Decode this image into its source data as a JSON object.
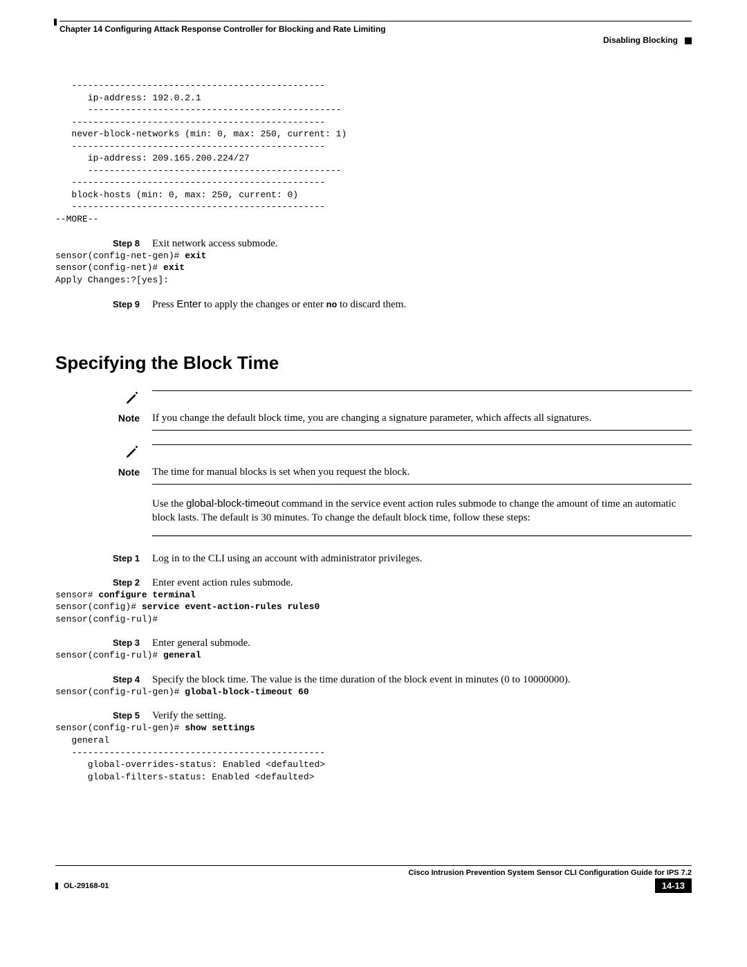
{
  "header": {
    "chapter": "Chapter 14      Configuring Attack Response Controller for Blocking and Rate Limiting",
    "section": "Disabling Blocking"
  },
  "code_block_top": "   -----------------------------------------------\n      ip-address: 192.0.2.1\n      -----------------------------------------------\n   -----------------------------------------------\n   never-block-networks (min: 0, max: 250, current: 1)\n   -----------------------------------------------\n      ip-address: 209.165.200.224/27\n      -----------------------------------------------\n   -----------------------------------------------\n   block-hosts (min: 0, max: 250, current: 0)\n   -----------------------------------------------\n--MORE--",
  "step8": {
    "label": "Step 8",
    "text": "Exit network access submode.",
    "code": "sensor(config-net-gen)# exit\nsensor(config-net)# exit\nApply Changes:?[yes]:"
  },
  "step9": {
    "label": "Step 9",
    "text_pre": "Press ",
    "enter": "Enter",
    "text_mid": " to apply the changes or enter ",
    "no_word": "no",
    "text_post": " to discard them."
  },
  "heading": "Specifying the Block Time",
  "note1": {
    "label": "Note",
    "text": "If you change the default block time, you are changing a signature parameter, which affects all signatures."
  },
  "note2": {
    "label": "Note",
    "text": "The time for manual blocks is set when you request the block."
  },
  "intro": {
    "pre": "Use the ",
    "cmd": "global-block-timeout",
    "post": " command in the service event action rules submode to change the amount of time an automatic block lasts. The default is 30 minutes. To change the default block time, follow these steps:"
  },
  "bstep1": {
    "label": "Step 1",
    "text": "Log in to the CLI using an account with administrator privileges."
  },
  "bstep2": {
    "label": "Step 2",
    "text": "Enter event action rules submode.",
    "code_plain1": "sensor# ",
    "code_bold1": "configure terminal",
    "code_plain2": "sensor(config)# ",
    "code_bold2": "service event-action-rules rules0",
    "code_plain3": "sensor(config-rul)#"
  },
  "bstep3": {
    "label": "Step 3",
    "text": "Enter general submode.",
    "code_plain": "sensor(config-rul)# ",
    "code_bold": "general"
  },
  "bstep4": {
    "label": "Step 4",
    "text": "Specify the block time. The value is the time duration of the block event in minutes (0 to 10000000).",
    "code_plain": "sensor(config-rul-gen)# ",
    "code_bold": "global-block-timeout 60"
  },
  "bstep5": {
    "label": "Step 5",
    "text": "Verify the setting.",
    "code_plain": "sensor(config-rul-gen)# ",
    "code_bold": "show settings",
    "code_rest": "   general\n   -----------------------------------------------\n      global-overrides-status: Enabled <defaulted>\n      global-filters-status: Enabled <defaulted>"
  },
  "footer": {
    "guide": "Cisco Intrusion Prevention System Sensor CLI Configuration Guide for IPS 7.2",
    "docid": "OL-29168-01",
    "pagenum": "14-13"
  }
}
